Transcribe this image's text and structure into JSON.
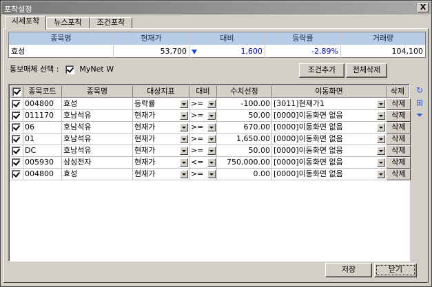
{
  "window": {
    "title": "포착설정",
    "close_label": "X"
  },
  "tabs": [
    {
      "label": "시세포착",
      "active": true
    },
    {
      "label": "뉴스포착",
      "active": false
    },
    {
      "label": "조건포착",
      "active": false
    }
  ],
  "quote": {
    "headers": [
      "종목명",
      "현재가",
      "대비",
      "등락률",
      "거래량"
    ],
    "name": "효성",
    "price": "53,700",
    "change": "1,600",
    "rate": "-2.89%",
    "volume": "104,100",
    "change_icon": "down-triangle-icon"
  },
  "notify": {
    "label": "통보매체 선택 :",
    "option": "MyNet W",
    "checked": true
  },
  "buttons": {
    "add": "조건추가",
    "delete_all": "전체삭제",
    "save": "저장",
    "close": "닫기"
  },
  "grid": {
    "headers": [
      "",
      "종목코드",
      "종목명",
      "대상지표",
      "대비",
      "수치선정",
      "이동화면",
      "삭제"
    ],
    "rows": [
      {
        "code": "004800",
        "name": "효성",
        "indicator": "등락률",
        "op": ">=",
        "value": "-100.00",
        "screen": "[3011]현재가1",
        "del": "삭제"
      },
      {
        "code": "011170",
        "name": "호남석유",
        "indicator": "현재가",
        "op": ">=",
        "value": "50.00",
        "screen": "[0000]이동화면 없음",
        "del": "삭제"
      },
      {
        "code": "06",
        "name": "호남석유",
        "indicator": "현재가",
        "op": ">=",
        "value": "670.00",
        "screen": "[0000]이동화면 없음",
        "del": "삭제"
      },
      {
        "code": "01",
        "name": "호남석유",
        "indicator": "현재가",
        "op": ">=",
        "value": "1,650.00",
        "screen": "[0000]이동화면 없음",
        "del": "삭제"
      },
      {
        "code": "DC",
        "name": "호남석유",
        "indicator": "현재가",
        "op": ">=",
        "value": "50.00",
        "screen": "[0000]이동화면 없음",
        "del": "삭제"
      },
      {
        "code": "005930",
        "name": "삼성전자",
        "indicator": "현재가",
        "op": "<=",
        "value": "750,000.00",
        "screen": "[0000]이동화면 없음",
        "del": "삭제"
      },
      {
        "code": "004800",
        "name": "효성",
        "indicator": "현재가",
        "op": ">=",
        "value": "0.00",
        "screen": "[0000]이동화면 없음",
        "del": "삭제"
      }
    ]
  },
  "side_icons": [
    "refresh-icon",
    "add-icon",
    "move-down-icon"
  ],
  "colors": {
    "header_blue": "#b8cce8",
    "down_blue": "#1848c8",
    "face": "#d4d0c8"
  }
}
